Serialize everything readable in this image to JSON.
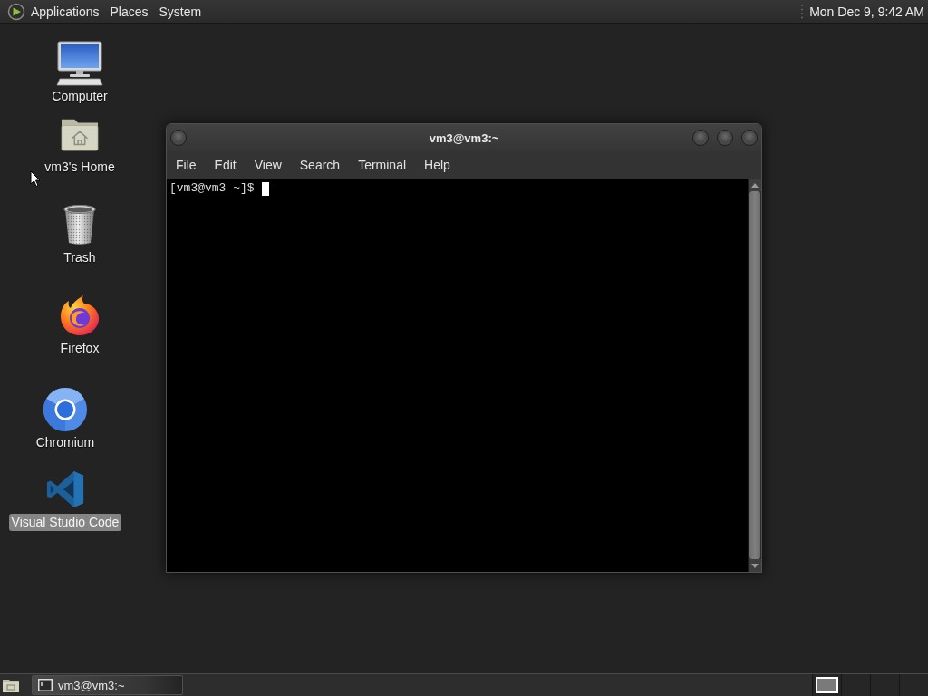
{
  "top_panel": {
    "menus": [
      "Applications",
      "Places",
      "System"
    ],
    "clock": "Mon Dec 9, 9:42 AM"
  },
  "desktop_icons": [
    {
      "label": "Computer",
      "kind": "computer",
      "selected": false
    },
    {
      "label": "vm3's Home",
      "kind": "home",
      "selected": false
    },
    {
      "label": "Trash",
      "kind": "trash",
      "selected": false
    },
    {
      "label": "Firefox",
      "kind": "firefox",
      "selected": false
    },
    {
      "label": "Chromium",
      "kind": "chromium",
      "selected": false
    },
    {
      "label": "Visual Studio Code",
      "kind": "vscode",
      "selected": true
    }
  ],
  "terminal_window": {
    "title": "vm3@vm3:~",
    "menu": [
      "File",
      "Edit",
      "View",
      "Search",
      "Terminal",
      "Help"
    ],
    "prompt": "[vm3@vm3 ~]$"
  },
  "bottom_panel": {
    "tasks": [
      {
        "label": "vm3@vm3:~"
      }
    ],
    "workspaces": [
      {
        "selected": true
      },
      {
        "selected": false
      },
      {
        "selected": false
      },
      {
        "selected": false
      }
    ]
  }
}
